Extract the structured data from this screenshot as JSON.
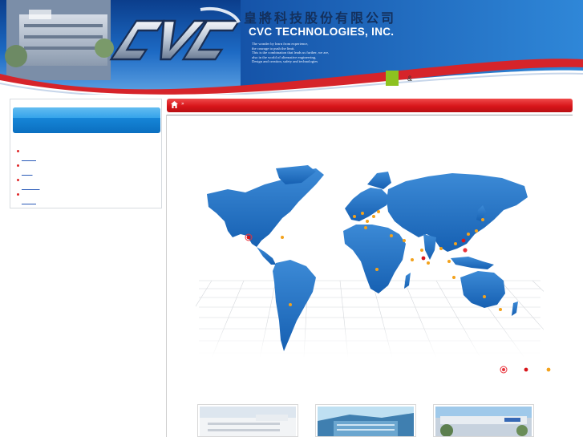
{
  "header": {
    "company_zh": "皇將科技股份有限公司",
    "company_en": "CVC TECHNOLOGIES, INC.",
    "logo_text": "CVC",
    "slogan_lines": [
      "The wonder by learn from experience,",
      "the courage to push the limit.",
      "This is the combination that leads us further, we are,",
      "also in the world of alternative engineering,",
      "Design and creation, safety and technologies"
    ],
    "ampersand": "&"
  },
  "left_nav": {
    "items": [
      "____",
      "___",
      "_____",
      "____"
    ]
  },
  "breadcrumb": {
    "separator": "»"
  },
  "map": {
    "locations": [
      {
        "region": "USA west",
        "type": "hq"
      },
      {
        "region": "USA east",
        "type": "office"
      },
      {
        "region": "Taiwan",
        "type": "hq"
      }
    ]
  },
  "slider": {
    "dots": 3,
    "active_index": 0
  },
  "thumbnails": [
    "office-building-1",
    "office-building-2",
    "office-building-3"
  ]
}
